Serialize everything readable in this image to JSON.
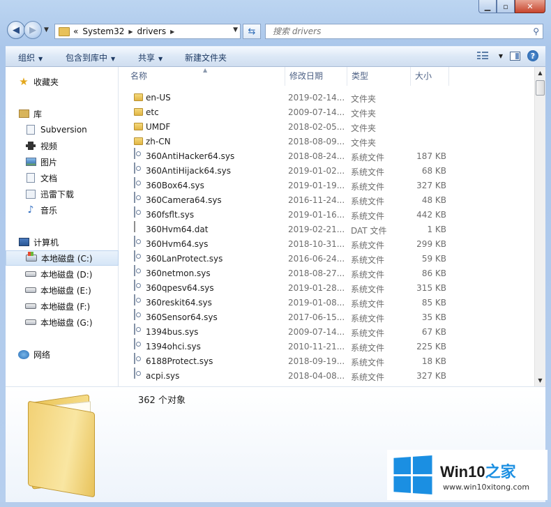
{
  "address": {
    "prefix": "«",
    "parts": [
      "System32",
      "drivers"
    ]
  },
  "search": {
    "placeholder": "搜索 drivers"
  },
  "caption": {
    "min": "▁",
    "max": "▫",
    "close": "✕"
  },
  "toolbar": {
    "organize": "组织",
    "include": "包含到库中",
    "share": "共享",
    "new_folder": "新建文件夹",
    "help": "?"
  },
  "nav": {
    "favorites": "收藏夹",
    "libraries": "库",
    "lib_items": [
      "Subversion",
      "视频",
      "图片",
      "文档",
      "迅雷下载",
      "音乐"
    ],
    "computer": "计算机",
    "drives": [
      "本地磁盘 (C:)",
      "本地磁盘 (D:)",
      "本地磁盘 (E:)",
      "本地磁盘 (F:)",
      "本地磁盘 (G:)"
    ],
    "network": "网络"
  },
  "columns": {
    "name": "名称",
    "date": "修改日期",
    "type": "类型",
    "size": "大小"
  },
  "files": [
    {
      "name": "en-US",
      "date": "2019-02-14...",
      "type": "文件夹",
      "size": "",
      "icon": "folder"
    },
    {
      "name": "etc",
      "date": "2009-07-14...",
      "type": "文件夹",
      "size": "",
      "icon": "folder"
    },
    {
      "name": "UMDF",
      "date": "2018-02-05...",
      "type": "文件夹",
      "size": "",
      "icon": "folder"
    },
    {
      "name": "zh-CN",
      "date": "2018-08-09...",
      "type": "文件夹",
      "size": "",
      "icon": "folder"
    },
    {
      "name": "360AntiHacker64.sys",
      "date": "2018-08-24...",
      "type": "系统文件",
      "size": "187 KB",
      "icon": "sys"
    },
    {
      "name": "360AntiHijack64.sys",
      "date": "2019-01-02...",
      "type": "系统文件",
      "size": "68 KB",
      "icon": "sys"
    },
    {
      "name": "360Box64.sys",
      "date": "2019-01-19...",
      "type": "系统文件",
      "size": "327 KB",
      "icon": "sys"
    },
    {
      "name": "360Camera64.sys",
      "date": "2016-11-24...",
      "type": "系统文件",
      "size": "48 KB",
      "icon": "sys"
    },
    {
      "name": "360fsflt.sys",
      "date": "2019-01-16...",
      "type": "系统文件",
      "size": "442 KB",
      "icon": "sys"
    },
    {
      "name": "360Hvm64.dat",
      "date": "2019-02-21...",
      "type": "DAT 文件",
      "size": "1 KB",
      "icon": "dat"
    },
    {
      "name": "360Hvm64.sys",
      "date": "2018-10-31...",
      "type": "系统文件",
      "size": "299 KB",
      "icon": "sys"
    },
    {
      "name": "360LanProtect.sys",
      "date": "2016-06-24...",
      "type": "系统文件",
      "size": "59 KB",
      "icon": "sys"
    },
    {
      "name": "360netmon.sys",
      "date": "2018-08-27...",
      "type": "系统文件",
      "size": "86 KB",
      "icon": "sys"
    },
    {
      "name": "360qpesv64.sys",
      "date": "2019-01-28...",
      "type": "系统文件",
      "size": "315 KB",
      "icon": "sys"
    },
    {
      "name": "360reskit64.sys",
      "date": "2019-01-08...",
      "type": "系统文件",
      "size": "85 KB",
      "icon": "sys"
    },
    {
      "name": "360Sensor64.sys",
      "date": "2017-06-15...",
      "type": "系统文件",
      "size": "35 KB",
      "icon": "sys"
    },
    {
      "name": "1394bus.sys",
      "date": "2009-07-14...",
      "type": "系统文件",
      "size": "67 KB",
      "icon": "sys"
    },
    {
      "name": "1394ohci.sys",
      "date": "2010-11-21...",
      "type": "系统文件",
      "size": "225 KB",
      "icon": "sys"
    },
    {
      "name": "6188Protect.sys",
      "date": "2018-09-19...",
      "type": "系统文件",
      "size": "18 KB",
      "icon": "sys"
    },
    {
      "name": "acpi.sys",
      "date": "2018-04-08...",
      "type": "系统文件",
      "size": "327 KB",
      "icon": "sys"
    }
  ],
  "status": {
    "count": "362 个对象"
  },
  "watermark": {
    "title": "Win10",
    "title_zh": "之家",
    "url": "www.win10xitong.com"
  },
  "colors": {
    "accent": "#1b8fe2",
    "folder": "#e1b544"
  }
}
